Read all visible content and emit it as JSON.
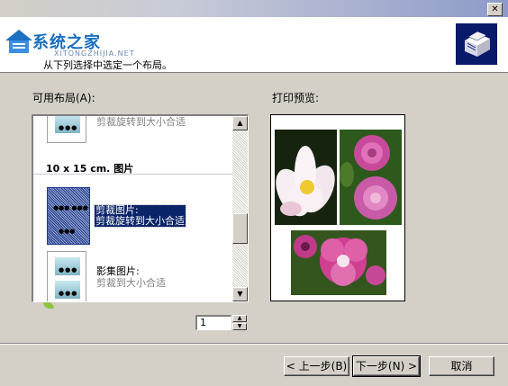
{
  "window": {
    "close_glyph": "✕"
  },
  "watermark": {
    "brand": "系统之家",
    "sub": "XITONGZHIJIA.NET"
  },
  "header": {
    "subtitle": "从下列选择中选定一个布局。",
    "icon": "printer-icon"
  },
  "layouts": {
    "label": "可用布局(A):",
    "items": [
      {
        "lines": [
          "剪裁旋转到大小合适"
        ],
        "style": "gray"
      },
      {
        "section": "10 x 15 cm. 图片"
      },
      {
        "lines": [
          "剪裁图片:",
          "剪裁旋转到大小合适"
        ],
        "selected": true
      },
      {
        "lines": [
          "影集图片:",
          "剪裁到大小合适"
        ]
      }
    ],
    "scroll_up": "▲",
    "scroll_down": "▼"
  },
  "preview": {
    "label": "打印预览:",
    "photos": [
      "white-lotus-flower",
      "pink-flowers",
      "pink-geranium-flowers"
    ]
  },
  "copies": {
    "value": "1",
    "up": "▲",
    "down": "▼"
  },
  "footer": {
    "back_label": "< 上一步(B)",
    "next_label": "下一步(N) >",
    "cancel_label": "取消"
  },
  "colors": {
    "selection": "#0a246a",
    "dialog": "#d4d0c8",
    "brand_blue": "#1a6fc2"
  }
}
